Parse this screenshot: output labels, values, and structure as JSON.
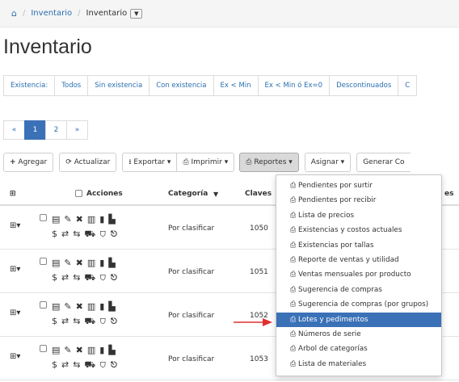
{
  "breadcrumb": {
    "home_icon": "⌂",
    "items": [
      "Inventario",
      "Inventario"
    ],
    "caret": "▼"
  },
  "page_title": "Inventario",
  "filters": [
    "Existencia:",
    "Todos",
    "Sin existencia",
    "Con existencia",
    "Ex < Min",
    "Ex < Min ó Ex=0",
    "Descontinuados",
    "C"
  ],
  "pagination": {
    "prev": "«",
    "pages": [
      "1",
      "2"
    ],
    "active": "1",
    "next": "»"
  },
  "toolbar": {
    "add": "Agregar",
    "refresh": "Actualizar",
    "export": "Exportar",
    "print": "Imprimir",
    "reports": "Reportes",
    "assign": "Asignar",
    "generate": "Generar Co"
  },
  "table": {
    "header_actions": "Acciones",
    "header_category": "Categoría",
    "header_keys": "Claves",
    "header_clipped": "es",
    "rows": [
      {
        "category": "Por clasificar",
        "key": "1050"
      },
      {
        "category": "Por clasificar",
        "key": "1051"
      },
      {
        "category": "Por clasificar",
        "key": "1052"
      },
      {
        "category": "Por clasificar",
        "key": "1053"
      }
    ]
  },
  "reports_menu": {
    "items": [
      "Pendientes por surtir",
      "Pendientes por recibir",
      "Lista de precios",
      "Existencias y costos actuales",
      "Existencias por tallas",
      "Reporte de ventas y utilidad",
      "Ventas mensuales por producto",
      "Sugerencia de compras",
      "Sugerencia de compras (por grupos)",
      "Lotes y pedimentos",
      "Números de serie",
      "Arbol de categorías",
      "Lista de materiales"
    ],
    "highlighted": "Lotes y pedimentos"
  },
  "colors": {
    "accent": "#3b71b7",
    "link": "#2a6fb0",
    "arrow": "#e03030"
  },
  "icons": [
    "home-icon",
    "plus-icon",
    "refresh-icon",
    "export-icon",
    "printer-icon",
    "caret-down-icon",
    "filter-icon",
    "row-action-icons"
  ]
}
